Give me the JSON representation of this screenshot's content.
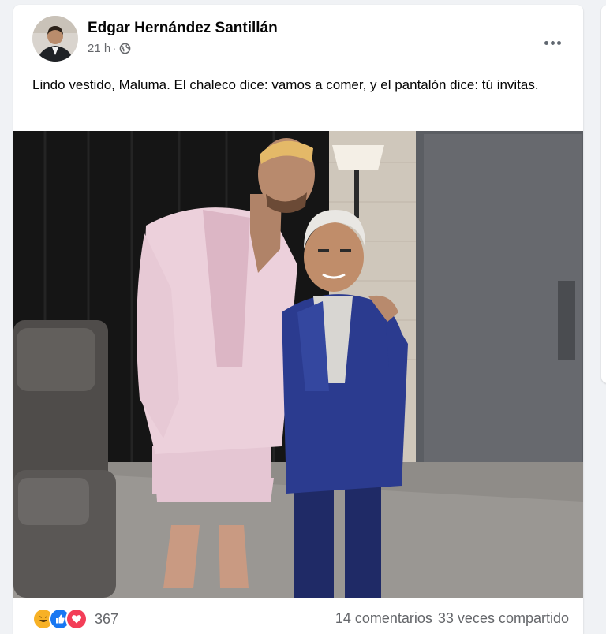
{
  "post": {
    "author": "Edgar Hernández Santillán",
    "time": "21 h",
    "separator": "·",
    "privacy_icon": "globe-icon",
    "more_icon": "more-options-icon",
    "text": "Lindo vestido, Maluma. El chaleco dice: vamos a comer, y el pantalón dice: tú invitas."
  },
  "reactions": {
    "icons": [
      "haha-icon",
      "like-icon",
      "love-icon"
    ],
    "count": "367"
  },
  "stats": {
    "comments": "14 comentarios",
    "shares": "33 veces compartido"
  },
  "colors": {
    "like": "#1877f2",
    "love": "#f33e58",
    "haha": "#f7b125",
    "suit_pink": "#e8c8d4",
    "suit_blue": "#2a3a8c"
  }
}
